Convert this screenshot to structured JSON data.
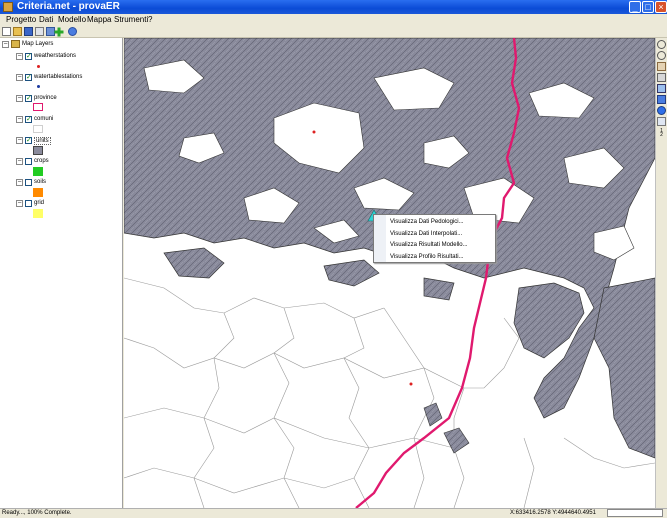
{
  "window": {
    "title": "Criteria.net - provaER"
  },
  "menu": [
    "Progetto",
    "Dati",
    "Modello",
    "Mappa",
    "Strumenti",
    "?"
  ],
  "layers": {
    "root": "Map Layers",
    "items": [
      {
        "name": "weatherstations",
        "checked": true,
        "swatch": "#dd2222"
      },
      {
        "name": "watertablestations",
        "checked": true,
        "swatch": "#1b3aa0"
      },
      {
        "name": "province",
        "checked": true,
        "swatch": "#e0196e"
      },
      {
        "name": "comuni",
        "checked": true,
        "swatch": "#ffffff"
      },
      {
        "name": "units",
        "checked": true,
        "swatch": "#8a8b9c"
      },
      {
        "name": "crops",
        "checked": false,
        "swatch": "#22cc22"
      },
      {
        "name": "soils",
        "checked": false,
        "swatch": "#ff8a00"
      },
      {
        "name": "grid",
        "checked": false,
        "swatch": "#ffff66"
      }
    ]
  },
  "context_menu": [
    "Visualizza Dati Pedologici...",
    "Visualizza Dati Interpolati...",
    "Visualizza Risultati Modello...",
    "Visualizza Profilo Risultati..."
  ],
  "status": {
    "message": "Ready..., 100% Complete.",
    "coordinates": "X:633416.2578 Y:4944640.4951"
  },
  "colors": {
    "title_bar": "#0b4bd6",
    "units_fill": "#8a8b9c",
    "province_line": "#e0196e",
    "station": "#dd2222"
  }
}
